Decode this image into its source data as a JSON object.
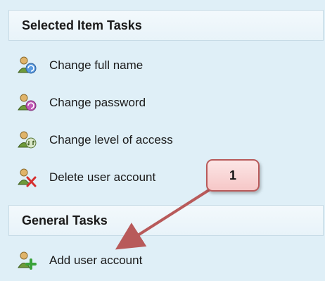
{
  "selected_item_tasks": {
    "header": "Selected Item Tasks",
    "items": [
      {
        "label": "Change full name",
        "icon": "user-refresh-icon"
      },
      {
        "label": "Change password",
        "icon": "user-password-icon"
      },
      {
        "label": "Change level of access",
        "icon": "user-access-icon"
      },
      {
        "label": "Delete user account",
        "icon": "user-delete-icon"
      }
    ]
  },
  "general_tasks": {
    "header": "General Tasks",
    "items": [
      {
        "label": "Add user account",
        "icon": "user-add-icon"
      }
    ]
  },
  "callout": {
    "label": "1",
    "color": "#b85a5a"
  },
  "colors": {
    "panel_background": "#dfeff7",
    "header_background": "#eef6fa"
  }
}
